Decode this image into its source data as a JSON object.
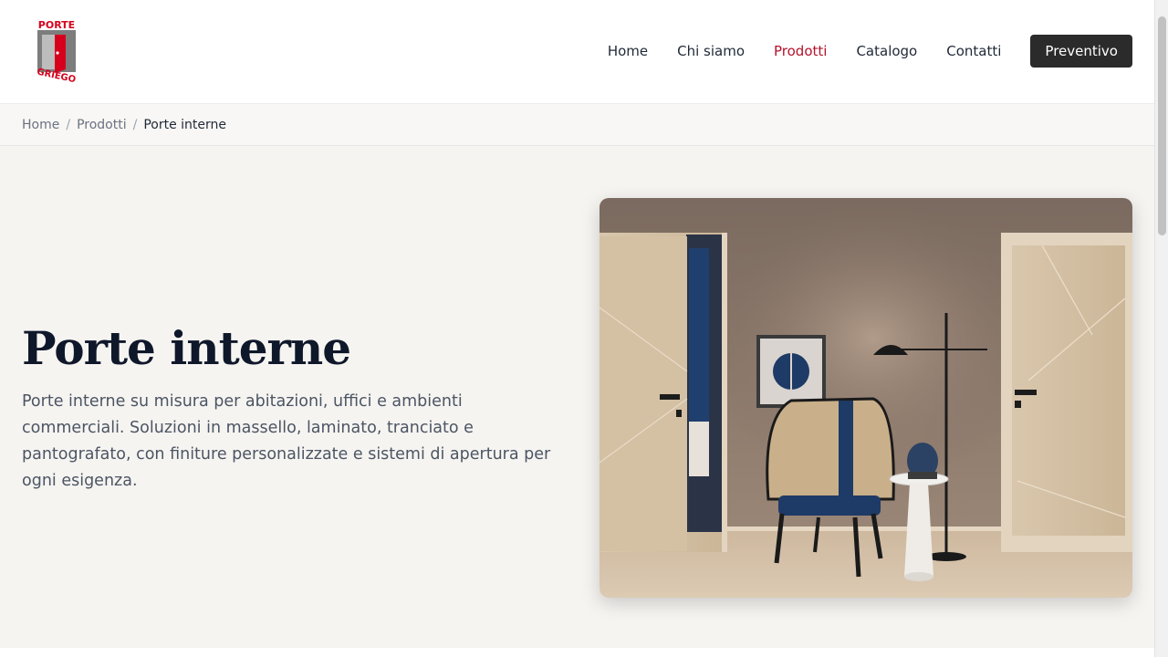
{
  "brand": {
    "logo_top": "PORTE",
    "logo_bottom": "GRIEGO",
    "logo_color": "#d6001c"
  },
  "nav": {
    "items": [
      {
        "label": "Home",
        "active": false
      },
      {
        "label": "Chi siamo",
        "active": false
      },
      {
        "label": "Prodotti",
        "active": true
      },
      {
        "label": "Catalogo",
        "active": false
      },
      {
        "label": "Contatti",
        "active": false
      }
    ],
    "cta_label": "Preventivo",
    "active_color": "#b5122c"
  },
  "breadcrumb": {
    "items": [
      "Home",
      "Prodotti",
      "Porte interne"
    ],
    "separator": "/"
  },
  "hero": {
    "title": "Porte interne",
    "description": "Porte interne su misura per abitazioni, uffici e ambienti commerciali. Soluzioni in massello, laminato, tranciato e pantografato, con finiture personalizzate e sistemi di apertura per ogni esigenza."
  }
}
